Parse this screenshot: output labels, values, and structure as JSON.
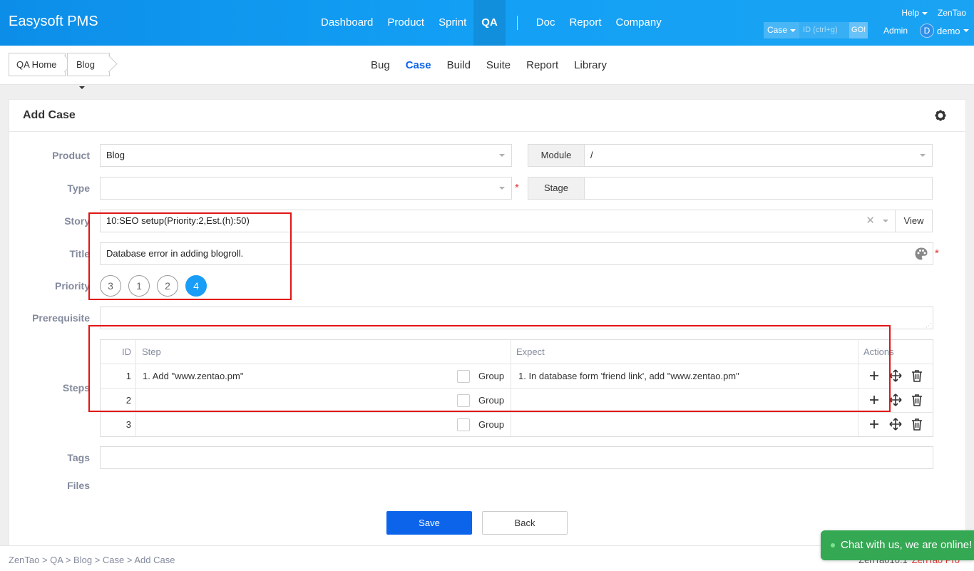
{
  "header": {
    "brand": "Easysoft PMS",
    "nav": [
      "Dashboard",
      "Product",
      "Sprint",
      "QA",
      "Doc",
      "Report",
      "Company"
    ],
    "active_nav": "QA",
    "help_label": "Help",
    "zentao_label": "ZenTao",
    "search_type": "Case",
    "search_placeholder": "ID (ctrl+g)",
    "search_go": "GO!",
    "admin_label": "Admin",
    "user_initial": "D",
    "user_name": "demo"
  },
  "subheader": {
    "breadcrumb_home": "QA Home",
    "breadcrumb_product": "Blog",
    "tabs": [
      "Bug",
      "Case",
      "Build",
      "Suite",
      "Report",
      "Library"
    ],
    "active_tab": "Case"
  },
  "form": {
    "title": "Add Case",
    "product_label": "Product",
    "product_value": "Blog",
    "module_label": "Module",
    "module_value": "/",
    "type_label": "Type",
    "type_value": "",
    "stage_label": "Stage",
    "stage_value": "",
    "story_label": "Story",
    "story_value": "10:SEO setup(Priority:2,Est.(h):50)",
    "story_view": "View",
    "title_label": "Title",
    "title_value": "Database error in adding blogroll.",
    "priority_label": "Priority",
    "priorities": [
      "3",
      "1",
      "2",
      "4"
    ],
    "priority_selected": "4",
    "prerequisite_label": "Prerequisite",
    "steps_label": "Steps",
    "tags_label": "Tags",
    "files_label": "Files",
    "required_mark": "*",
    "save_label": "Save",
    "back_label": "Back"
  },
  "steps_table": {
    "headers": {
      "id": "ID",
      "step": "Step",
      "expect": "Expect",
      "actions": "Actions"
    },
    "group_label": "Group",
    "rows": [
      {
        "id": "1",
        "step": "1. Add \"www.zentao.pm\"",
        "expect": "1. In database form 'friend link', add \"www.zentao.pm\""
      },
      {
        "id": "2",
        "step": "",
        "expect": ""
      },
      {
        "id": "3",
        "step": "",
        "expect": ""
      }
    ]
  },
  "footer": {
    "crumbs": "ZenTao > QA > Blog > Case > Add Case",
    "version": "ZenTao10.1",
    "pro": "ZenTao Pro"
  },
  "chat": {
    "label": "Chat with us, we are online!"
  },
  "colors": {
    "header_bg": "#13a0f5",
    "primary": "#0c64eb",
    "priority_active": "#1a9df6",
    "highlight": "#e21515",
    "chat_bg": "#35a854"
  }
}
